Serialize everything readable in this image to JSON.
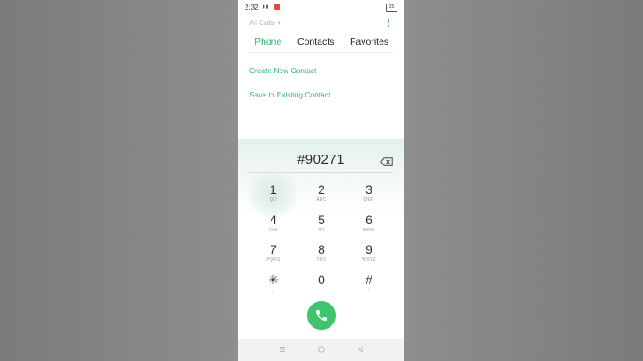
{
  "status_bar": {
    "time": "2:32",
    "signal_icons": "▏▎▍",
    "notification_badge": "",
    "battery_level": "25"
  },
  "top_bar": {
    "filter_label": "All Calls"
  },
  "tabs": [
    {
      "label": "Phone",
      "active": true
    },
    {
      "label": "Contacts",
      "active": false
    },
    {
      "label": "Favorites",
      "active": false
    }
  ],
  "actions": {
    "create_new_contact": "Create New Contact",
    "save_to_existing_contact": "Save to Existing Contact"
  },
  "dialer": {
    "entered_number": "#90271",
    "keys": [
      {
        "num": "1",
        "letters": "QD"
      },
      {
        "num": "2",
        "letters": "ABC"
      },
      {
        "num": "3",
        "letters": "DEF"
      },
      {
        "num": "4",
        "letters": "GHI"
      },
      {
        "num": "5",
        "letters": "JKL"
      },
      {
        "num": "6",
        "letters": "MNO"
      },
      {
        "num": "7",
        "letters": "PQRS"
      },
      {
        "num": "8",
        "letters": "TUV"
      },
      {
        "num": "9",
        "letters": "WXYZ"
      },
      {
        "num": "✳",
        "letters": ","
      },
      {
        "num": "0",
        "letters": "+"
      },
      {
        "num": "#",
        "letters": ";"
      }
    ]
  },
  "colors": {
    "accent_green": "#35b56b",
    "call_button": "#3ec46d"
  },
  "icons": {
    "more": "more-vertical-icon",
    "backspace": "backspace-icon",
    "call": "phone-icon",
    "nav_menu": "menu-icon",
    "nav_home": "home-icon",
    "nav_back": "back-icon"
  }
}
